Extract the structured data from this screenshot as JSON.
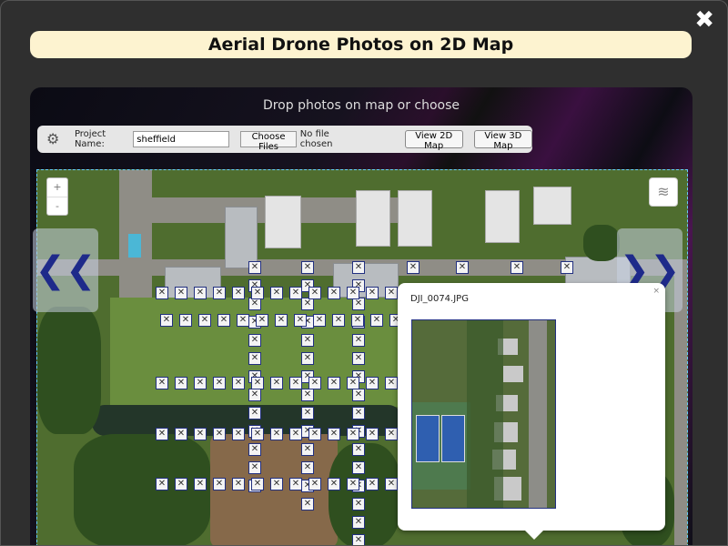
{
  "window": {
    "title": "Aerial Drone Photos on 2D Map",
    "close_icon": "close-icon",
    "close_glyph": "✖"
  },
  "panel": {
    "drop_hint": "Drop photos on map or choose"
  },
  "toolbar": {
    "settings_icon": "gear-icon",
    "project_label": "Project Name:",
    "project_value": "sheffield",
    "choose_files_label": "Choose Files",
    "no_file_text": "No file chosen",
    "view_2d_label": "View 2D Map",
    "view_3d_label": "View 3D Map"
  },
  "map": {
    "zoom_in": "+",
    "zoom_out": "-",
    "layers_icon": "layers-icon",
    "prev_icon": "chevron-double-left-icon",
    "prev_glyph": "❮❮",
    "next_icon": "chevron-double-right-icon",
    "next_glyph": "❯❯",
    "marker_glyph": "✕",
    "popup": {
      "filename": "DJI_0074.JPG",
      "close": "×"
    }
  }
}
